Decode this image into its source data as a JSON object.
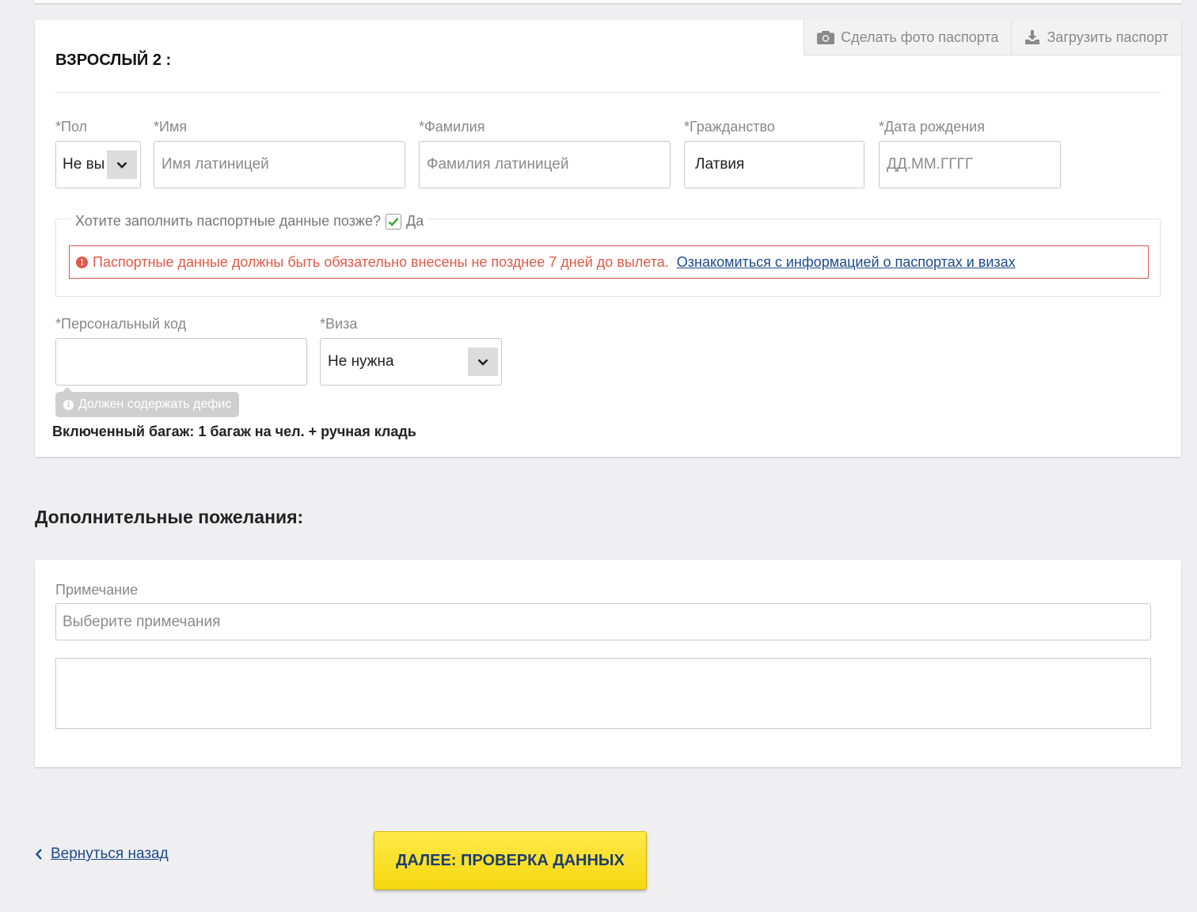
{
  "passenger": {
    "title": "ВЗРОСЛЫЙ 2 :",
    "actions": {
      "photo_label": "Сделать фото паспорта",
      "upload_label": "Загрузить паспорт"
    },
    "fields": {
      "gender": {
        "label": "*Пол",
        "value": "Не вы"
      },
      "first_name": {
        "label": "*Имя",
        "placeholder": "Имя латиницей"
      },
      "last_name": {
        "label": "*Фамилия",
        "placeholder": "Фамилия латиницей"
      },
      "citizenship": {
        "label": "*Гражданство",
        "value": "Латвия"
      },
      "birth_date": {
        "label": "*Дата рождения",
        "placeholder": "ДД.ММ.ГГГГ"
      },
      "personal_code": {
        "label": "*Персональный код",
        "value": ""
      },
      "visa": {
        "label": "*Виза",
        "value": "Не нужна"
      }
    },
    "passport_later": {
      "question": "Хотите заполнить паспортные данные позже?",
      "checkbox_label": "Да",
      "checked": true
    },
    "alert": {
      "text": "Паспортные данные должны быть обязательно внесены не позднее 7 дней до вылета.",
      "link": "Ознакомиться с информацией о паспортах и визах"
    },
    "personal_code_hint": "Должен содержать дефис",
    "baggage": "Включенный багаж: 1 багаж на чел. + ручная кладь"
  },
  "wishes": {
    "title": "Дополнительные пожелания:",
    "note_label": "Примечание",
    "note_placeholder": "Выберите примечания",
    "note_text": ""
  },
  "footer": {
    "back_label": "Вернуться назад",
    "next_label": "ДАЛЕЕ: ПРОВЕРКА ДАННЫХ"
  },
  "colors": {
    "accent_yellow": "#f6d80f",
    "link_blue": "#1e4a8c",
    "alert_red": "#e05a4a",
    "checkbox_green": "#3aa335"
  }
}
